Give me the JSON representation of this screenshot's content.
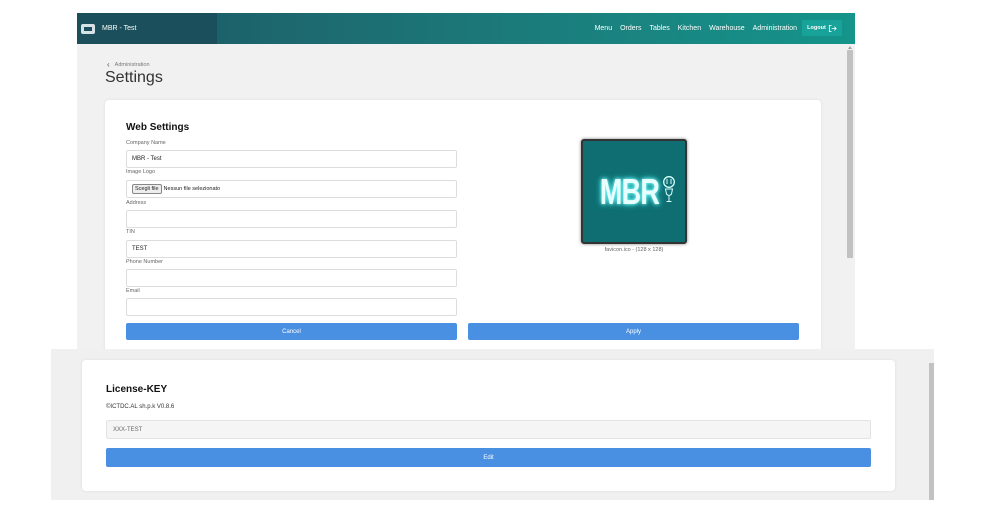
{
  "brand": {
    "name": "MBR - Test"
  },
  "nav": {
    "links": [
      "Menu",
      "Orders",
      "Tables",
      "Kitchen",
      "Warehouse",
      "Administration"
    ],
    "logout_label": "Logout"
  },
  "breadcrumb": {
    "parent": "Administration"
  },
  "page": {
    "title": "Settings"
  },
  "web_settings": {
    "title": "Web Settings",
    "fields": {
      "company_name": {
        "label": "Company Name",
        "value": "MBR - Test"
      },
      "image_logo": {
        "label": "Image Logo",
        "button": "Scegli file",
        "status": "Nessun file selezionato"
      },
      "address": {
        "label": "Address",
        "value": ""
      },
      "tin": {
        "label": "TIN",
        "value": "TEST"
      },
      "phone": {
        "label": "Phone Number",
        "value": ""
      },
      "email": {
        "label": "Email",
        "value": ""
      }
    },
    "logo": {
      "text": "MBR",
      "caption": "favicon.ico - (128 x 128)"
    },
    "cancel_label": "Cancel",
    "apply_label": "Apply"
  },
  "license": {
    "title": "License-KEY",
    "version": "©ICTDC.AL sh.p.k V0.8.6",
    "key": "XXX-TEST",
    "edit_label": "Edit"
  },
  "colors": {
    "primary_button": "#4a90e2",
    "navbar_start": "#1b5560",
    "navbar_end": "#14948a",
    "logo_bg": "#0e6e71"
  }
}
